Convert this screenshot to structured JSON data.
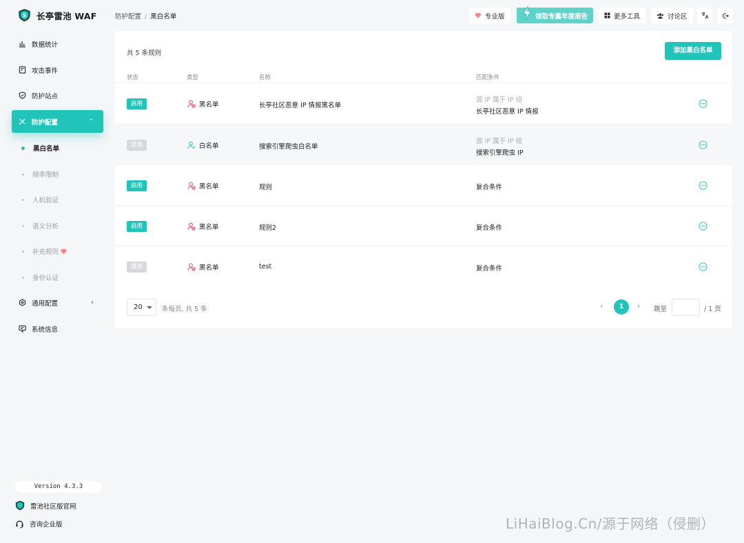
{
  "app": {
    "title": "长亭雷池 WAF"
  },
  "sidebar": {
    "items": [
      {
        "label": "数据统计",
        "icon": "bar-chart-icon"
      },
      {
        "label": "攻击事件",
        "icon": "document-icon"
      },
      {
        "label": "防护站点",
        "icon": "shield-icon"
      },
      {
        "label": "防护配置",
        "icon": "tools-icon",
        "active": true
      },
      {
        "label": "通用配置",
        "icon": "gear-icon"
      },
      {
        "label": "系统信息",
        "icon": "monitor-icon"
      }
    ],
    "sub_items": [
      {
        "label": "黑白名单",
        "active": true
      },
      {
        "label": "频率限制"
      },
      {
        "label": "人机验证"
      },
      {
        "label": "语义分析"
      },
      {
        "label": "补充规则",
        "icon": "diamond-icon"
      },
      {
        "label": "身份认证"
      }
    ],
    "version": "Version 4.3.3",
    "footer_links": [
      {
        "label": "雷池社区版官网",
        "icon": "shield-logo-icon"
      },
      {
        "label": "咨询企业版",
        "icon": "headset-icon"
      }
    ]
  },
  "header": {
    "breadcrumb": [
      "防护配置",
      "黑白名单"
    ],
    "pro_label": "专业版",
    "promo_label": "领取专属年度报告",
    "tools_label": "更多工具",
    "forum_label": "讨论区"
  },
  "main": {
    "rule_count": "共 5 条规则",
    "add_button": "添加黑白名单",
    "columns": [
      "状态",
      "类型",
      "名称",
      "匹配条件"
    ],
    "rows": [
      {
        "status": "启用",
        "enabled": true,
        "type": "黑名单",
        "name": "长亭社区恶意 IP 情报黑名单",
        "cond_label": "源 IP 属于 IP 组",
        "cond_value": "长亭社区恶意 IP 情报"
      },
      {
        "status": "禁用",
        "enabled": false,
        "type": "白名单",
        "name": "搜索引擎爬虫白名单",
        "cond_label": "源 IP 属于 IP 组",
        "cond_value": "搜索引擎爬虫 IP"
      },
      {
        "status": "启用",
        "enabled": true,
        "type": "黑名单",
        "name": "规则",
        "cond_label": "",
        "cond_value": "复合条件"
      },
      {
        "status": "启用",
        "enabled": true,
        "type": "黑名单",
        "name": "规则2",
        "cond_label": "",
        "cond_value": "复合条件"
      },
      {
        "status": "禁用",
        "enabled": false,
        "type": "黑名单",
        "name": "test",
        "cond_label": "",
        "cond_value": "复合条件"
      }
    ],
    "pagination": {
      "page_size": "20",
      "info": "条每页, 共 5 条",
      "current_page": "1",
      "jump_label": "跳至",
      "total_pages": "/ 1 页"
    }
  },
  "watermark": "LiHaiBlog.Cn/源于网络（侵删）",
  "colors": {
    "accent": "#20c4b8",
    "blacklist": "#e8455e",
    "whitelist": "#20c4b8"
  }
}
